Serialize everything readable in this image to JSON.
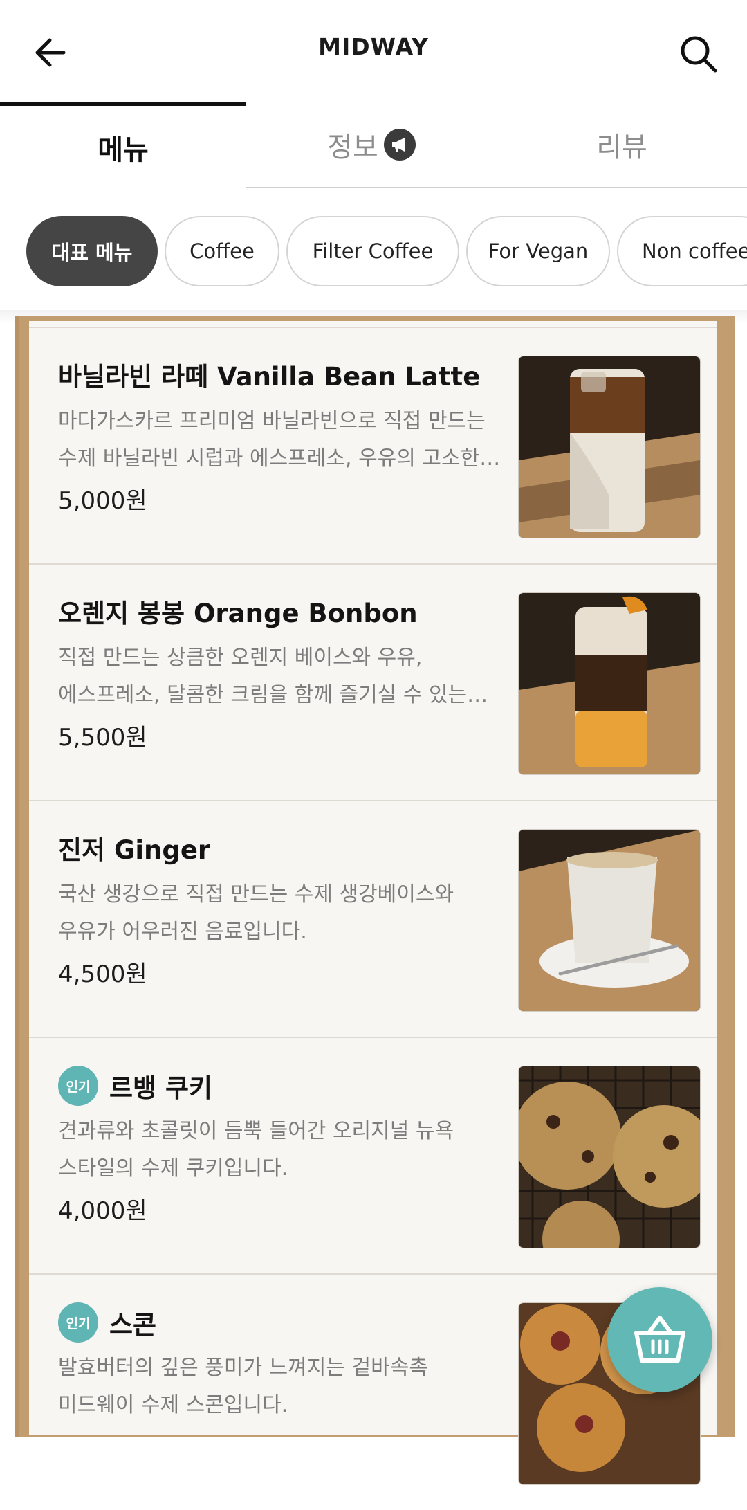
{
  "header": {
    "title": "MIDWAY",
    "back_icon": "arrow-left-icon",
    "search_icon": "search-icon"
  },
  "tabs": [
    {
      "label": "메뉴",
      "selected": true
    },
    {
      "label": "정보",
      "icon": "megaphone-icon"
    },
    {
      "label": "리뷰"
    }
  ],
  "categories": [
    {
      "label": "대표 메뉴",
      "selected": true
    },
    {
      "label": "Coffee"
    },
    {
      "label": "Filter Coffee"
    },
    {
      "label": "For Vegan"
    },
    {
      "label": "Non coffee"
    }
  ],
  "menu_items": [
    {
      "name": "바닐라빈 라떼 Vanilla Bean Latte",
      "badge": "",
      "description_line1": "마다가스카르 프리미엄 바닐라빈으로 직접 만드는",
      "description_line2": "수제 바닐라빈 시럽과 에스프레소, 우유의 고소한…",
      "price": "5,000원"
    },
    {
      "name": "오렌지 봉봉 Orange Bonbon",
      "badge": "",
      "description_line1": "직접 만드는 상큼한 오렌지 베이스와 우유,",
      "description_line2": "에스프레소, 달콤한 크림을 함께 즐기실 수 있는…",
      "price": "5,500원"
    },
    {
      "name": "진저 Ginger",
      "badge": "",
      "description_line1": "국산 생강으로 직접 만드는 수제 생강베이스와",
      "description_line2": "우유가 어우러진 음료입니다.",
      "price": "4,500원"
    },
    {
      "name": "르뱅 쿠키",
      "badge": "인기",
      "description_line1": "견과류와 초콜릿이 듬뿍 들어간 오리지널 뉴욕",
      "description_line2": "스타일의 수제 쿠키입니다.",
      "price": "4,000원"
    },
    {
      "name": "스콘",
      "badge": "인기",
      "description_line1": "발효버터의 깊은 풍미가 느껴지는 겉바속촉",
      "description_line2": "미드웨이 수제 스콘입니다.",
      "price": ""
    }
  ],
  "cart": {
    "icon": "basket-icon"
  },
  "colors": {
    "accent_teal": "#62b8b5",
    "chip_active": "#454545",
    "board_frame": "#c19d70"
  }
}
